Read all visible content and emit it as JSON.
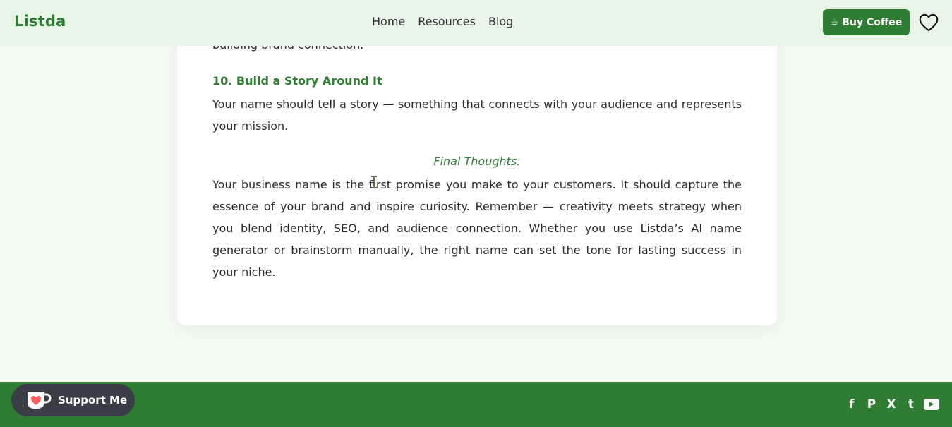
{
  "header": {
    "logo": "Listda",
    "nav": [
      "Home",
      "Resources",
      "Blog"
    ],
    "buy_coffee": "Buy Coffee",
    "cup_glyph": "☕"
  },
  "article": {
    "partial_line": "building brand connection.",
    "section_heading": "10. Build a Story Around It",
    "section_text": "Your name should tell a story — something that connects with your audience and represents your mission.",
    "final_heading": "Final Thoughts:",
    "final_text": "Your business name is the first promise you make to your customers. It should capture the essence of your brand and inspire curiosity. Remember — creativity meets strategy when you blend identity, SEO, and audience connection. Whether you use Listda’s AI name generator or brainstorm manually, the right name can set the tone for lasting success in your niche."
  },
  "footer": {
    "support_label": "Support Me",
    "social_glyphs": {
      "facebook": "f",
      "pinterest": "P",
      "x": "X",
      "tumblr": "t",
      "youtube": "▶"
    }
  },
  "colors": {
    "accent": "#2e7d32",
    "header_bg": "#e8f5e8",
    "page_bg": "#f3fbf3",
    "support_bg": "#3a3d45",
    "kofi_heart": "#ff5e5b"
  },
  "icons": [
    "heart-outline-icon",
    "coffee-cup-icon",
    "text-cursor-icon",
    "kofi-cup-icon",
    "facebook-icon",
    "pinterest-icon",
    "x-icon",
    "tumblr-icon",
    "youtube-icon"
  ]
}
